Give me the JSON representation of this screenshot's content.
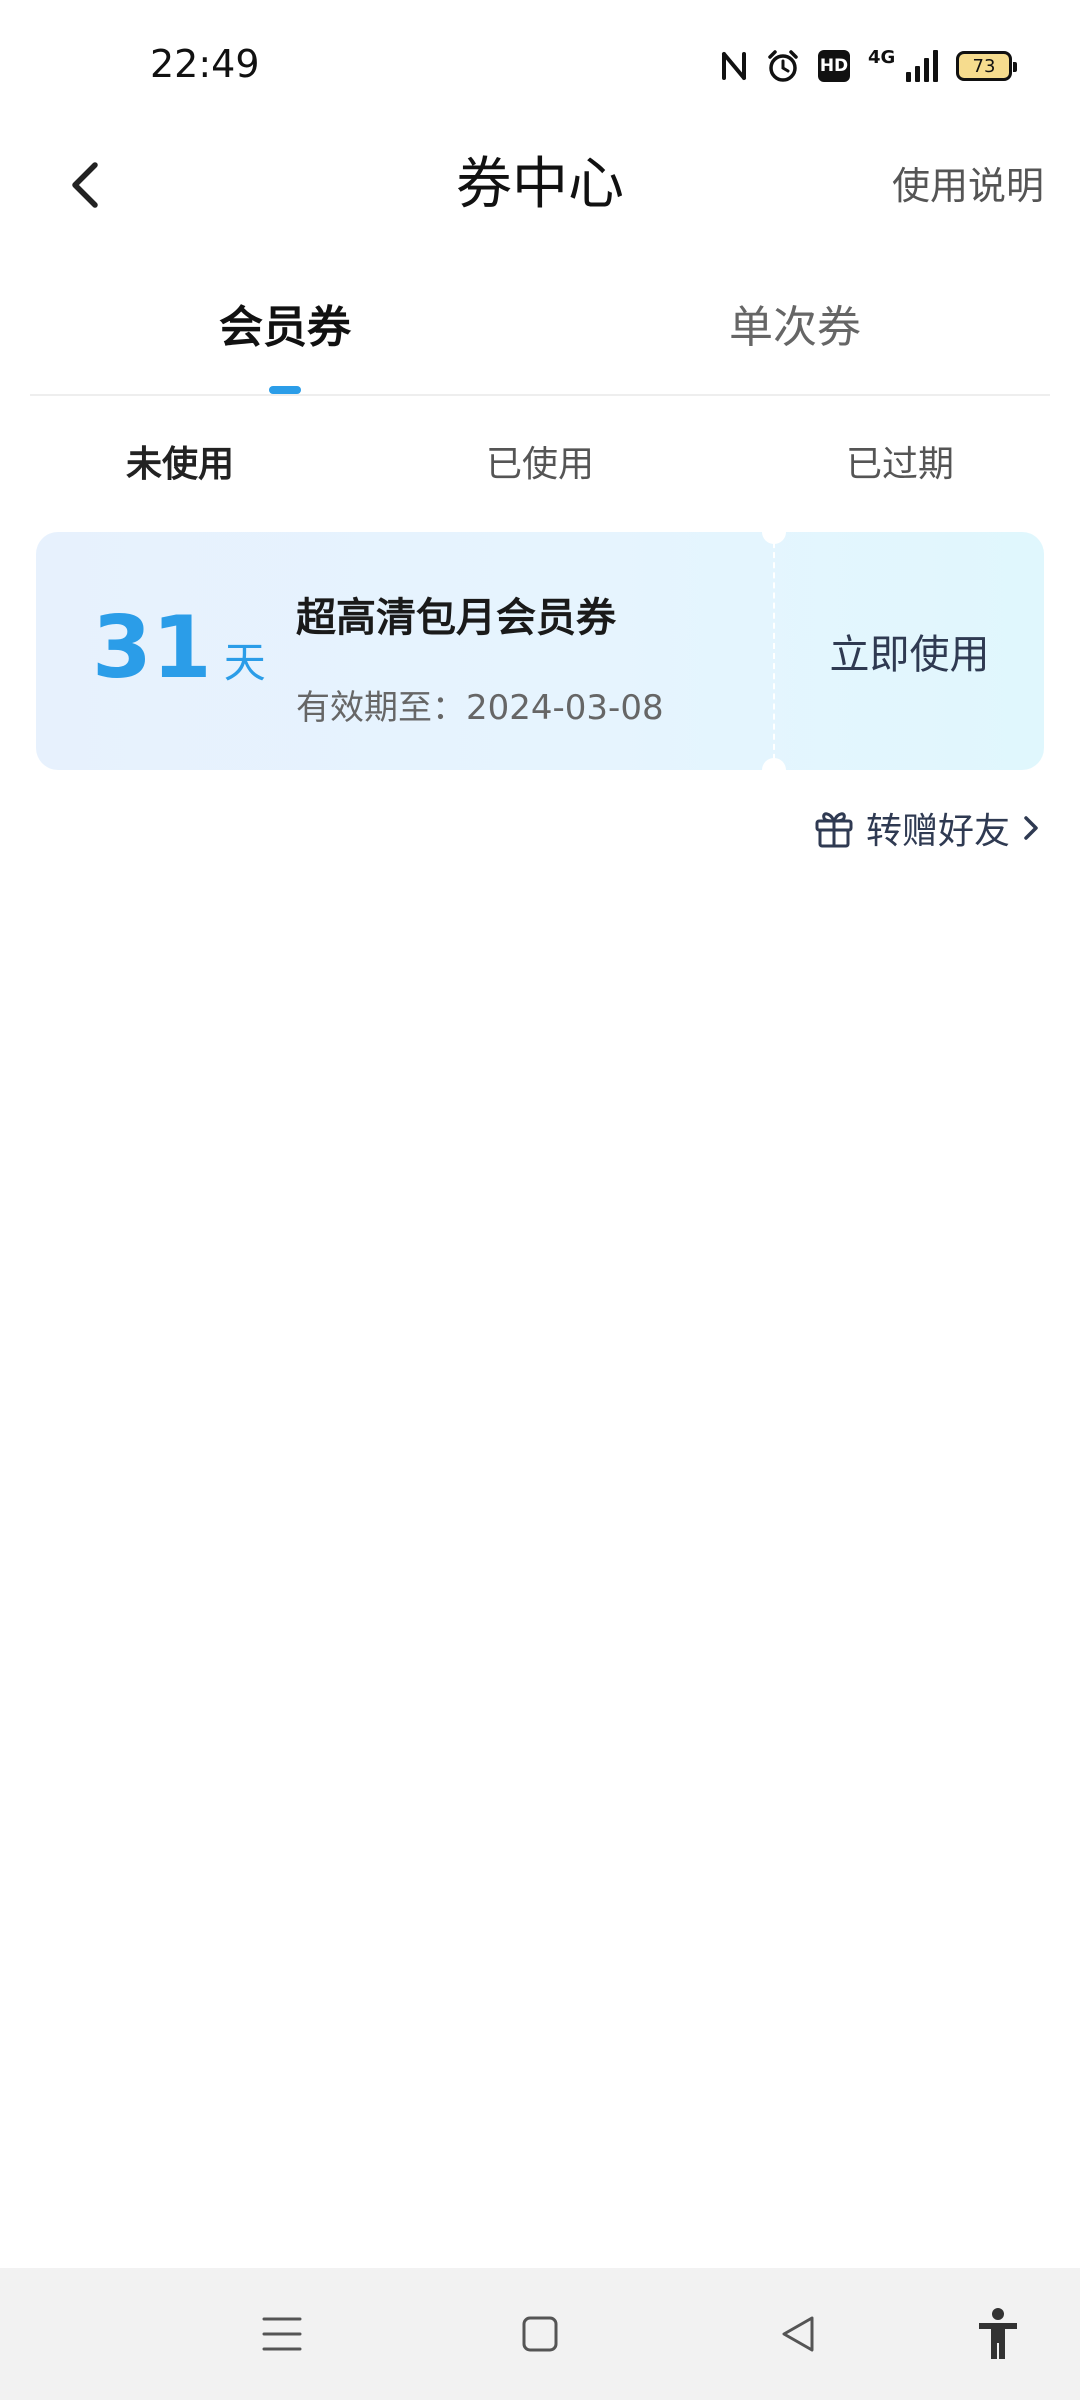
{
  "status_bar": {
    "time": "22:49",
    "hd_label": "HD",
    "network_label": "4G",
    "battery_level": "73",
    "icons": [
      "nfc-icon",
      "alarm-icon",
      "hd-icon",
      "network-4g-icon",
      "signal-icon",
      "battery-icon"
    ]
  },
  "header": {
    "title": "券中心",
    "help_label": "使用说明"
  },
  "main_tabs": [
    {
      "label": "会员券",
      "active": true
    },
    {
      "label": "单次券",
      "active": false
    }
  ],
  "sub_tabs": [
    {
      "label": "未使用",
      "active": true
    },
    {
      "label": "已使用",
      "active": false
    },
    {
      "label": "已过期",
      "active": false
    }
  ],
  "coupon": {
    "days": "31",
    "days_unit": "天",
    "name": "超高清包月会员券",
    "expiry": "有效期至：2024-03-08",
    "use_label": "立即使用"
  },
  "gift": {
    "label": "转赠好友"
  },
  "nav_bar": {
    "icons": [
      "menu-icon",
      "home-icon",
      "back-triangle-icon",
      "accessibility-icon"
    ]
  },
  "colors": {
    "accent": "#2b9de8",
    "text_dark": "#111111",
    "text_muted": "#666666",
    "card_start": "#e7f1fd",
    "card_end": "#e0f7fd"
  }
}
